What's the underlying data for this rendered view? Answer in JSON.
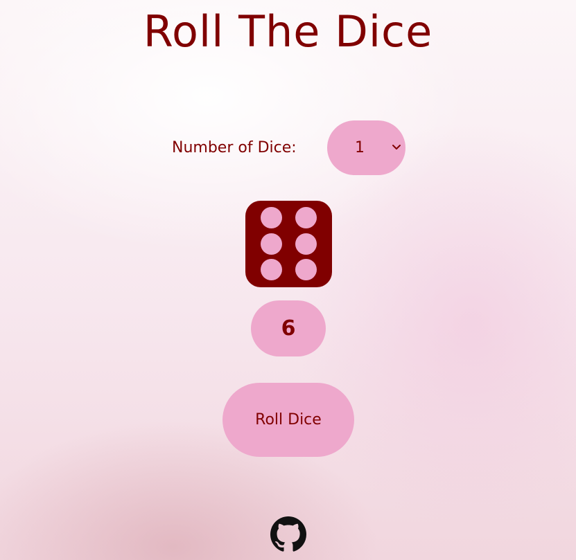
{
  "header": {
    "title": "Roll The Dice"
  },
  "controls": {
    "dice_count_label": "Number of Dice:",
    "dice_count_selected": "1"
  },
  "dice": [
    {
      "value": 6
    }
  ],
  "result": {
    "total": "6"
  },
  "actions": {
    "roll_label": "Roll Dice"
  },
  "footer": {
    "icon": "github-icon"
  },
  "colors": {
    "accent": "#800000",
    "pill": "#eea8cc"
  }
}
